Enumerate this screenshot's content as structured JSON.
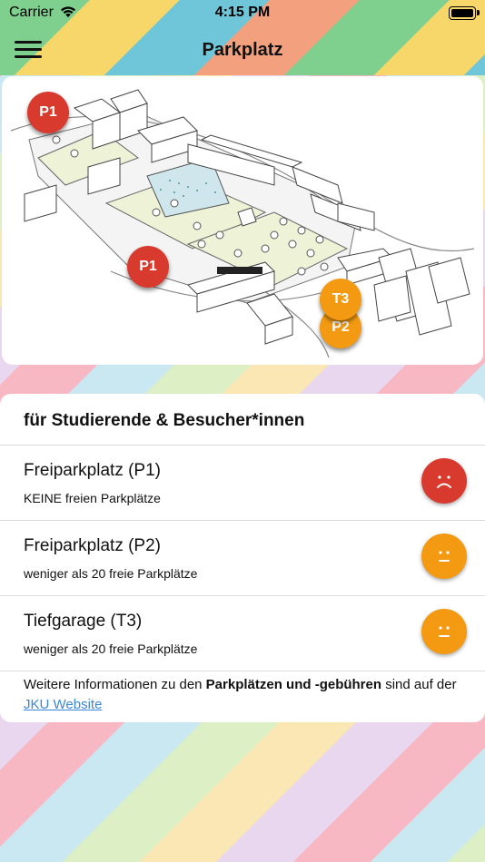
{
  "status_bar": {
    "carrier": "Carrier",
    "time": "4:15 PM"
  },
  "nav": {
    "title": "Parkplatz",
    "menu_icon": "hamburger-menu-icon"
  },
  "map": {
    "pins": [
      {
        "label": "P1",
        "color": "#d93a2e"
      },
      {
        "label": "P1",
        "color": "#d93a2e"
      },
      {
        "label": "P2",
        "color": "#f39a12"
      },
      {
        "label": "T3",
        "color": "#f39a12"
      }
    ]
  },
  "parking": {
    "section_title": "für Studierende & Besucher*innen",
    "items": [
      {
        "title": "Freiparkplatz (P1)",
        "status": "KEINE freien Parkplätze",
        "indicator": "sad-face-icon",
        "color": "#d93a2e"
      },
      {
        "title": "Freiparkplatz (P2)",
        "status": "weniger als 20 freie Parkplätze",
        "indicator": "neutral-face-icon",
        "color": "#f39a12"
      },
      {
        "title": "Tiefgarage (T3)",
        "status": "weniger als 20 freie Parkplätze",
        "indicator": "neutral-face-icon",
        "color": "#f39a12"
      }
    ]
  },
  "footer": {
    "text_before": "Weitere Informationen zu den ",
    "text_bold": "Parkplätzen und -gebühren",
    "text_after": " sind auf der ",
    "link_label": "JKU Website"
  }
}
